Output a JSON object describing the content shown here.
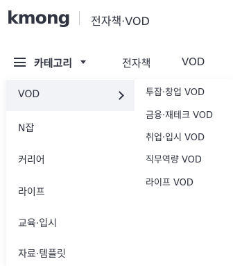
{
  "header": {
    "logo": "kmong",
    "service": "전자책·VOD"
  },
  "nav": {
    "category_label": "카테고리",
    "tabs": [
      "전자책",
      "VOD"
    ]
  },
  "menu": {
    "items": [
      {
        "label": "VOD",
        "active": true
      },
      {
        "label": "N잡"
      },
      {
        "label": "커리어"
      },
      {
        "label": "라이프"
      },
      {
        "label": "교육·입시"
      },
      {
        "label": "자료·템플릿"
      }
    ],
    "sub_items": [
      "투잡·창업 VOD",
      "금융·재테크 VOD",
      "취업·입시 VOD",
      "직무역량 VOD",
      "라이프 VOD"
    ]
  }
}
